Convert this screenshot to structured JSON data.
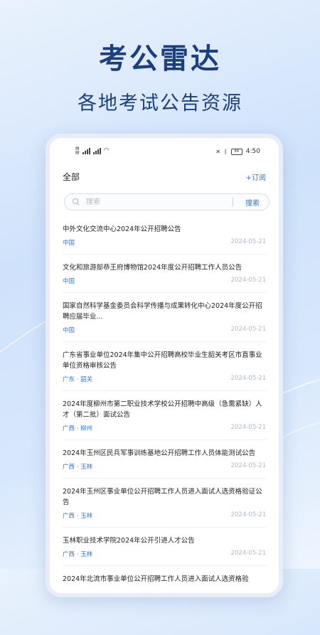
{
  "hero": {
    "title": "考公雷达",
    "subtitle": "各地考试公告资源"
  },
  "status_bar": {
    "time": "4:50",
    "battery": "84"
  },
  "header": {
    "title": "全部",
    "subscribe_label": "+订阅"
  },
  "search": {
    "placeholder": "搜索",
    "button_label": "搜索"
  },
  "colors": {
    "accent": "#2f74d8",
    "hero_text": "#1d3f7c"
  },
  "announcements": [
    {
      "title": "中外文化交流中心2024年公开招聘公告",
      "region": "中国",
      "date": "2024-05-21"
    },
    {
      "title": "文化和旅游部恭王府博物馆2024年度公开招聘工作人员公告",
      "region": "中国",
      "date": "2024-05-21"
    },
    {
      "title": "国家自然科学基金委员会科学传播与成果转化中心2024年度公开招聘应届毕业...",
      "region": "中国",
      "date": "2024-05-21"
    },
    {
      "title": "广东省事业单位2024年集中公开招聘高校毕业生韶关考区市直事业单位资格审核公告",
      "region": "广东 · 韶关",
      "date": "2024-05-21"
    },
    {
      "title": "2024年度柳州市第二职业技术学校公开招聘中高级（急需紧缺）人才（第二批）面试公告",
      "region": "广西 · 柳州",
      "date": "2024-05-21"
    },
    {
      "title": "2024年玉州区民兵军事训练基地公开招聘工作人员体能测试公告",
      "region": "广西 · 玉林",
      "date": "2024-05-21"
    },
    {
      "title": "2024年玉州区事业单位公开招聘工作人员进入面试人选资格验证公告",
      "region": "广西 · 玉林",
      "date": "2024-05-21"
    },
    {
      "title": "玉林职业技术学院2024年公开引进人才公告",
      "region": "广西 · 玉林",
      "date": "2024-05-21"
    },
    {
      "title": "2024年北流市事业单位公开招聘工作人员进入面试人选资格验",
      "region": "",
      "date": ""
    }
  ]
}
